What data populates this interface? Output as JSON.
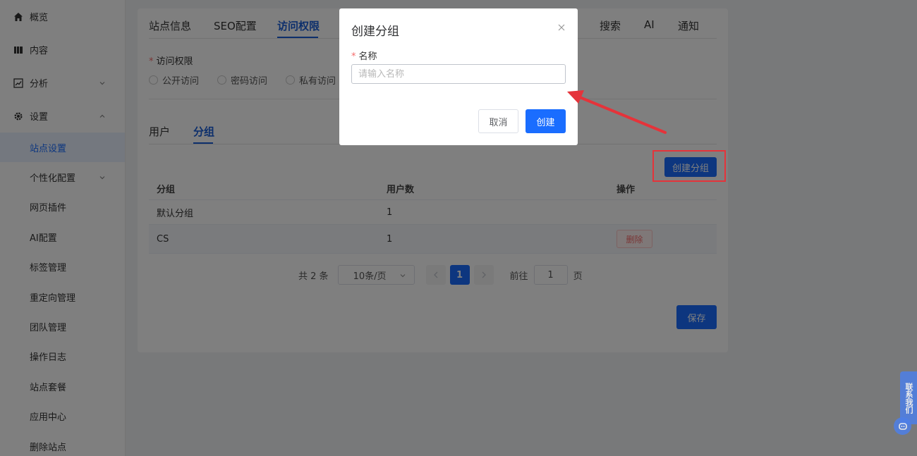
{
  "sidebar": {
    "items": [
      {
        "label": "概览",
        "icon": "home-icon"
      },
      {
        "label": "内容",
        "icon": "content-icon"
      },
      {
        "label": "分析",
        "icon": "chart-icon"
      },
      {
        "label": "设置",
        "icon": "gear-icon"
      }
    ],
    "sub_items": [
      "站点设置",
      "个性化配置",
      "网页插件",
      "AI配置",
      "标签管理",
      "重定向管理",
      "团队管理",
      "操作日志",
      "站点套餐",
      "应用中心",
      "删除站点"
    ]
  },
  "tabs": [
    "站点信息",
    "SEO配置",
    "访问权限",
    "搜索",
    "AI",
    "通知"
  ],
  "access": {
    "label": "访问权限",
    "options": [
      "公开访问",
      "密码访问",
      "私有访问"
    ]
  },
  "subtabs": [
    "用户",
    "分组"
  ],
  "create_group_button": "创建分组",
  "table": {
    "headers": [
      "分组",
      "用户数",
      "操作"
    ],
    "rows": [
      {
        "group": "默认分组",
        "users": "1",
        "action": ""
      },
      {
        "group": "CS",
        "users": "1",
        "action": "删除"
      }
    ]
  },
  "pagination": {
    "total": "共 2 条",
    "page_size": "10条/页",
    "current": "1",
    "jump_label": "前往",
    "jump_value": "1",
    "page_suffix": "页"
  },
  "save_button": "保存",
  "modal": {
    "title": "创建分组",
    "field_label": "名称",
    "placeholder": "请输入名称",
    "cancel": "取消",
    "confirm": "创建"
  },
  "contact_widget": "联系我们",
  "colors": {
    "primary": "#1a6dff",
    "annotation": "#e5333a",
    "danger": "#f56c6c"
  }
}
